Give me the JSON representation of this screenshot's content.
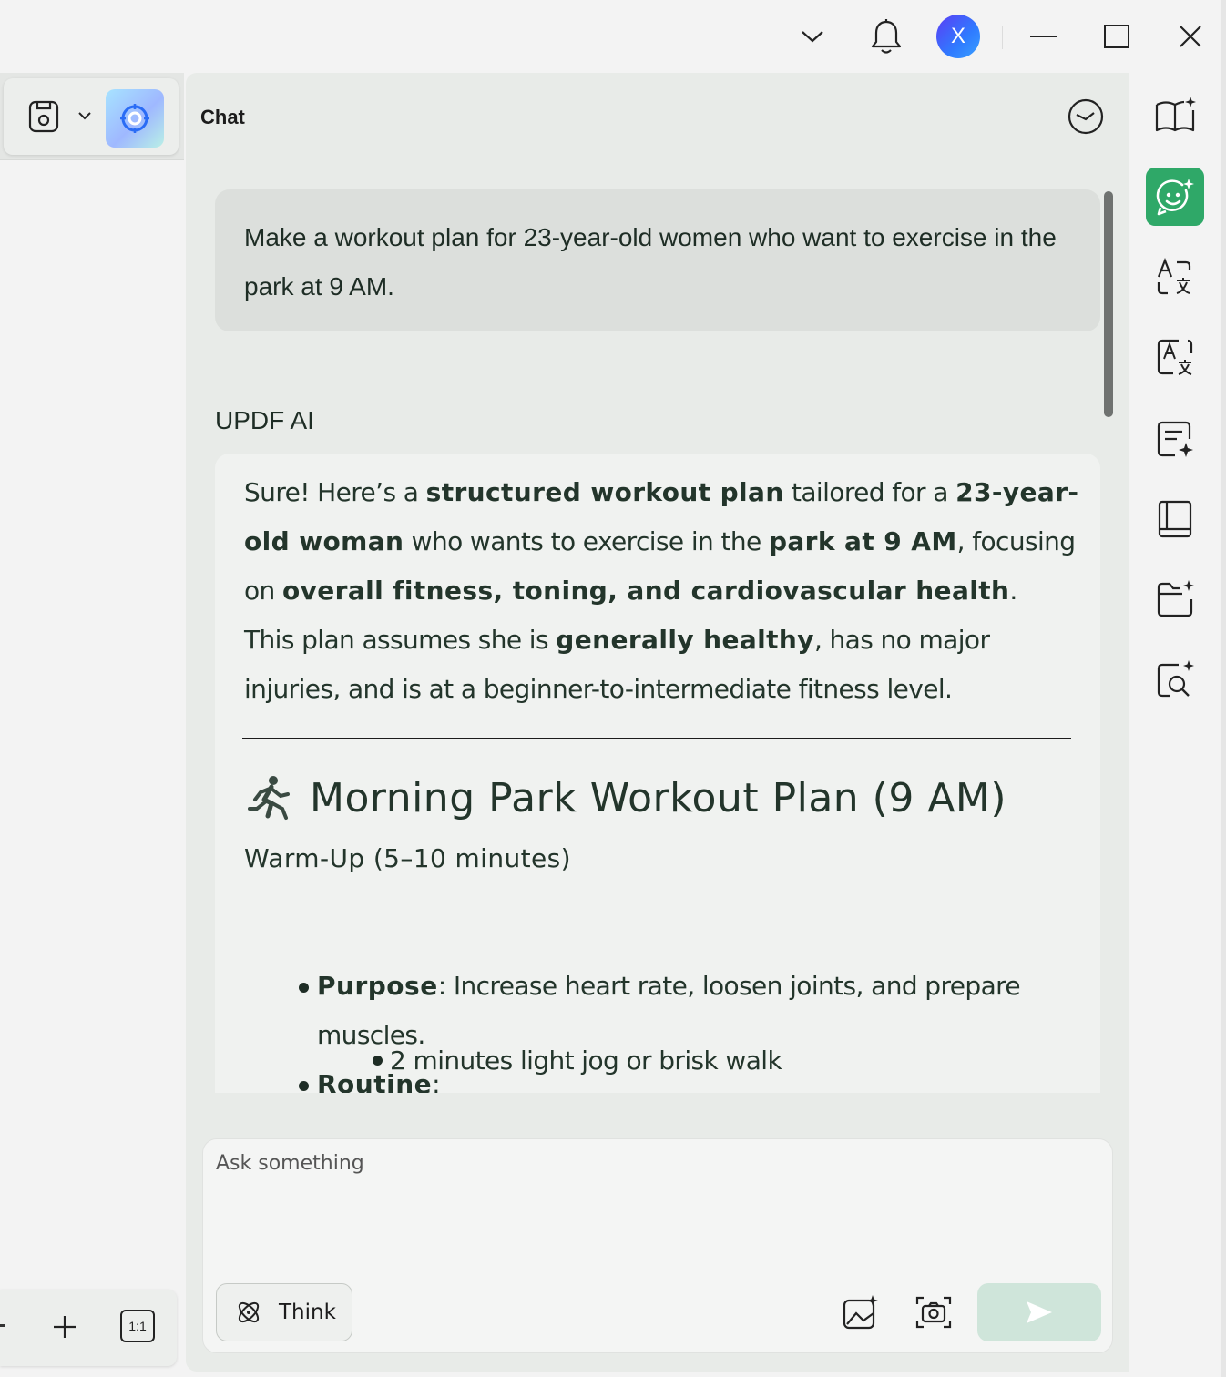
{
  "chat": {
    "title": "Chat",
    "user_message": "Make a workout plan for 23-year-old women who want to exercise in the park at 9 AM.",
    "ai_label": "UPDF AI",
    "response": {
      "p1_a": "Sure! Here’s a ",
      "p1_b": "structured workout plan",
      "p1_c": " tailored for a ",
      "p1_d": "23-year-old woman",
      "p1_e": " who wants to exercise in the ",
      "p1_f": "park at 9 AM",
      "p1_g": ", focusing on ",
      "p1_h": "overall fitness, toning, and cardiovascular health",
      "p1_i": ".",
      "p2_a": "This plan assumes she is ",
      "p2_b": "generally healthy",
      "p2_c": ", has no major injuries, and is at a beginner-to-intermediate fitness level.",
      "heading": "Morning Park Workout Plan (9 AM)",
      "subheading": "Warm-Up (5–10 minutes)",
      "purpose_label": "Purpose",
      "purpose_text": ": Increase heart rate, loosen joints, and prepare",
      "purpose_text_2": "muscles.",
      "routine_label": "Routine",
      "routine_colon": ":",
      "routine_item_1": "2 minutes light jog or brisk walk"
    }
  },
  "input": {
    "placeholder": "Ask something",
    "think_label": "Think"
  },
  "user": {
    "avatar_initial": "X"
  },
  "left_panel": {
    "ratio_label": "1:1"
  },
  "colors": {
    "accent": "#2fa868",
    "avatar": "#3a6cf7",
    "send_disabled": "#cfe5da"
  }
}
